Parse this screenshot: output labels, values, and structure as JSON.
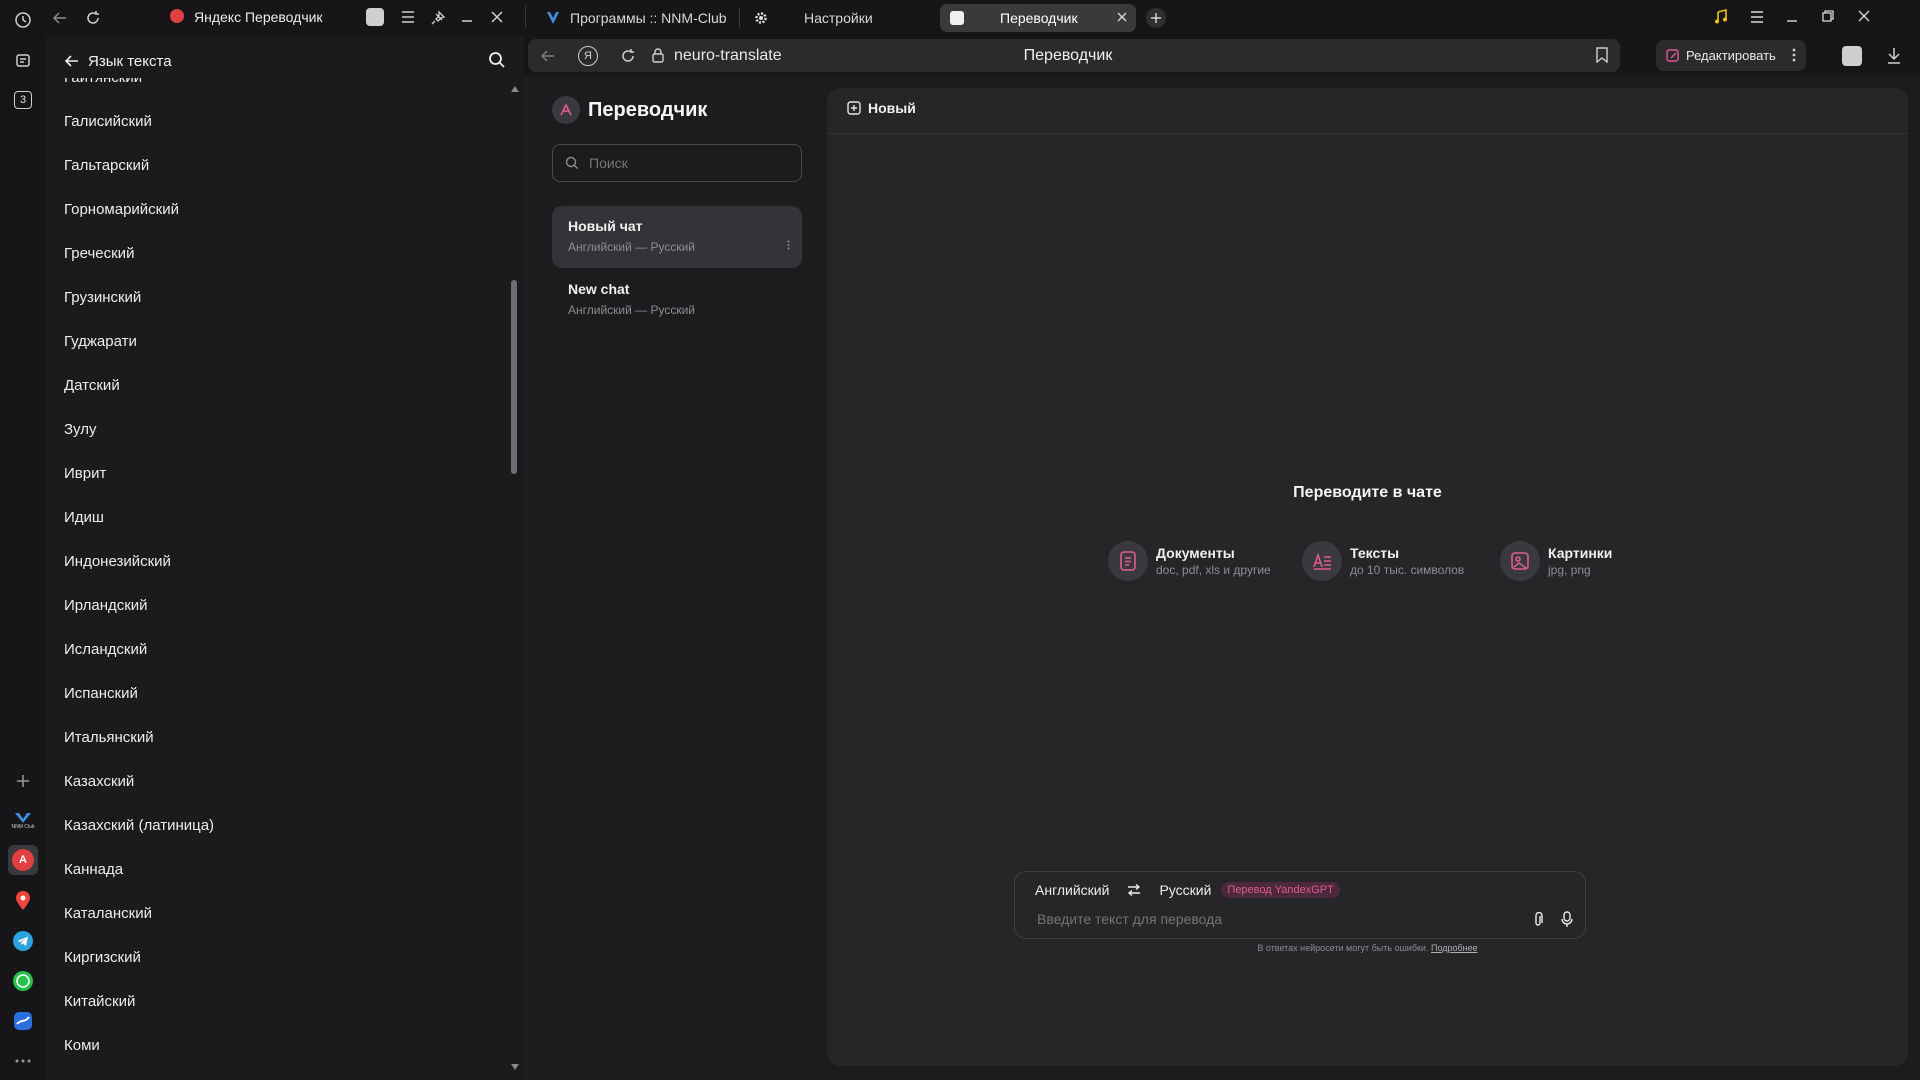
{
  "rail": {
    "notif_count": "3",
    "nnm_label": "NNM Club"
  },
  "sidepanel": {
    "title": "Язык текста",
    "languages": [
      "Гаитянский",
      "Галисийский",
      "Гальтарский",
      "Горномарийский",
      "Греческий",
      "Грузинский",
      "Гуджарати",
      "Датский",
      "Зулу",
      "Иврит",
      "Идиш",
      "Индонезийский",
      "Ирландский",
      "Исландский",
      "Испанский",
      "Итальянский",
      "Казахский",
      "Казахский (латиница)",
      "Каннада",
      "Каталанский",
      "Киргизский",
      "Китайский",
      "Коми"
    ]
  },
  "tabs": [
    {
      "label": "Яндекс Переводчик"
    },
    {
      "label": "Программы :: NNM-Club"
    },
    {
      "label": "Настройки"
    },
    {
      "label": "Переводчик"
    }
  ],
  "addressbar": {
    "url": "neuro-translate",
    "page_title": "Переводчик",
    "edit_label": "Редактировать"
  },
  "app": {
    "title": "Переводчик",
    "search_placeholder": "Поиск",
    "chats": [
      {
        "title": "Новый чат",
        "subtitle": "Английский — Русский"
      },
      {
        "title": "New chat",
        "subtitle": "Английский — Русский"
      }
    ],
    "new_label": "Новый",
    "heading": "Переводите в чате",
    "features": [
      {
        "title": "Документы",
        "subtitle": "doc, pdf, xls и другие",
        "icon": "document-icon"
      },
      {
        "title": "Тексты",
        "subtitle": "до 10 тыс. символов",
        "icon": "text-icon"
      },
      {
        "title": "Картинки",
        "subtitle": "jpg, png",
        "icon": "image-icon"
      }
    ],
    "source_lang": "Английский",
    "target_lang": "Русский",
    "badge": "Перевод YandexGPT",
    "input_placeholder": "Введите текст для перевода",
    "disclaimer": "В ответах нейросети могут быть ошибки.",
    "disclaimer_link": "Подробнее"
  },
  "colors": {
    "accent": "#e05b8f",
    "badge_bg": "#4a2a3a",
    "panel": "#262629"
  }
}
